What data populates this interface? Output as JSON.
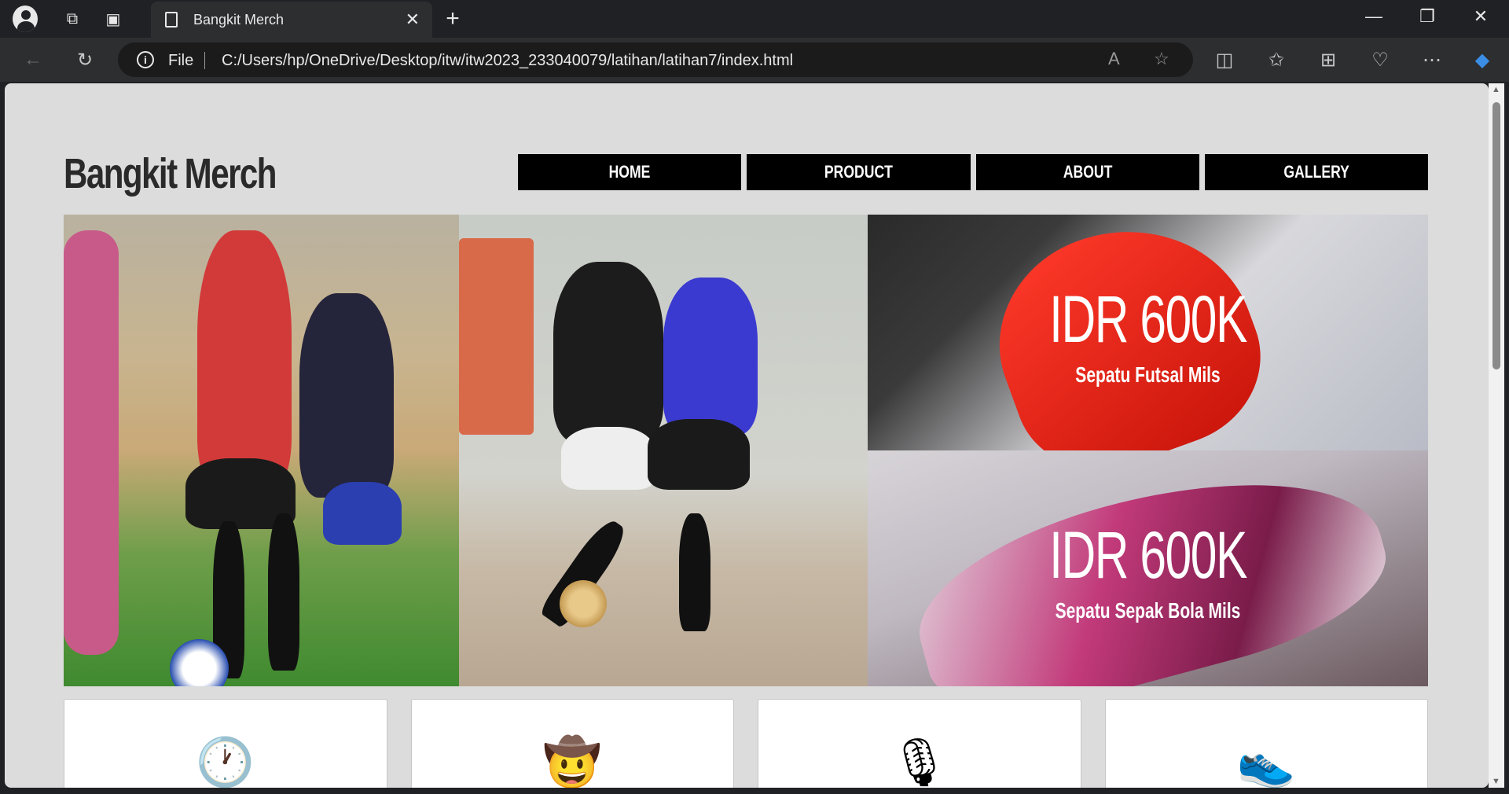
{
  "browser": {
    "tab_title": "Bangkit Merch",
    "address_label": "File",
    "url": "C:/Users/hp/OneDrive/Desktop/itw/itw2023_233040079/latihan/latihan7/index.html"
  },
  "site": {
    "title": "Bangkit Merch",
    "nav": [
      "HOME",
      "PRODUCT",
      "ABOUT",
      "GALLERY"
    ]
  },
  "hero": {
    "products": [
      {
        "price": "IDR 600K",
        "name": "Sepatu Futsal Mils"
      },
      {
        "price": "IDR 600K",
        "name": "Sepatu Sepak Bola Mils"
      }
    ]
  },
  "cards": [
    {
      "icon": "clock-icon",
      "glyph": "🕐"
    },
    {
      "icon": "cowboy-face-icon",
      "glyph": "🤠"
    },
    {
      "icon": "microphone-icon",
      "glyph": "🎙"
    },
    {
      "icon": "sneaker-icon",
      "glyph": "👟"
    }
  ]
}
